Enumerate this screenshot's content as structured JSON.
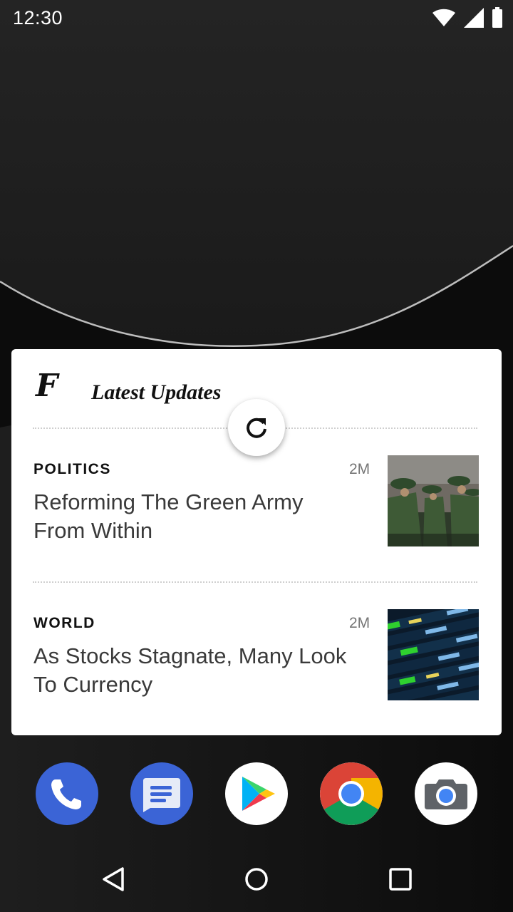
{
  "status_bar": {
    "time": "12:30",
    "icons": [
      "wifi-icon",
      "cellular-signal-icon",
      "battery-icon"
    ]
  },
  "widget": {
    "brand_mark": "F",
    "title": "Latest Updates",
    "refresh_icon": "refresh-icon",
    "articles": [
      {
        "category": "POLITICS",
        "time": "2M",
        "headline": "Reforming The Green Army From Within",
        "thumbnail": "soldiers-in-formation-image"
      },
      {
        "category": "WORLD",
        "time": "2M",
        "headline": "As Stocks Stagnate, Many Look To Currency",
        "thumbnail": "stock-ticker-board-image"
      }
    ]
  },
  "dock": {
    "apps": [
      "phone-app-icon",
      "messages-app-icon",
      "play-store-app-icon",
      "chrome-app-icon",
      "camera-app-icon"
    ]
  },
  "nav_bar": {
    "buttons": [
      "back-icon",
      "home-icon",
      "recents-icon"
    ]
  },
  "colors": {
    "widget_bg": "#ffffff",
    "wallpaper_dark": "#1c1c1c",
    "accent_blue": "#3b64d6"
  }
}
